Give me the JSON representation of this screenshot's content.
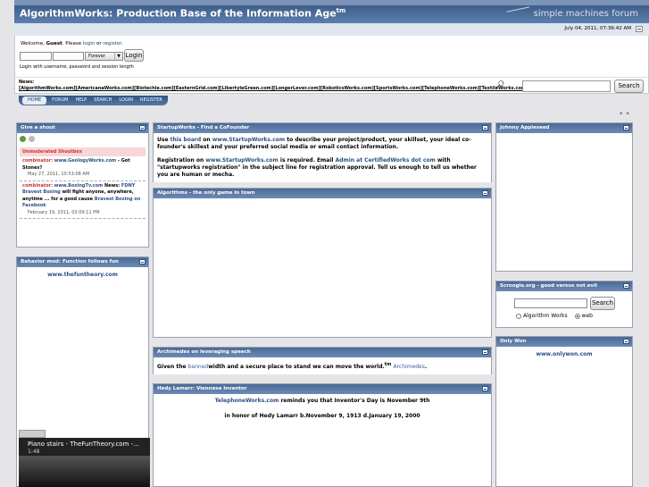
{
  "header": {
    "title": "AlgorithmWorks: Production Base of the Information Age",
    "title_sup": "tm",
    "brand": "simple machines forum"
  },
  "datetime": "July 04, 2011, 07:36:42 AM",
  "login": {
    "welcome_prefix": "Welcome, ",
    "guest": "Guest",
    "please": ". Please ",
    "login_link": "login",
    "or": " or ",
    "register_link": "register",
    "end": ".",
    "duration_option": "Forever",
    "login_button": "Login",
    "hint": "Login with username, password and session length"
  },
  "news": {
    "label": "News:",
    "links": "[AlgorithmWorks.com][AmericanaWorks.com][Biotechie.com][EasternGrid.com][LibertyleGreen.com][LongerLever.com][RoboticsWorks.com][SportsWorks.com][TelephoneWorks.com][TextileWorks.com][WLAB.com]"
  },
  "search": {
    "button": "Search"
  },
  "menu": [
    "HOME",
    "FORUM",
    "HELP",
    "SEARCH",
    "LOGIN",
    "REGISTER"
  ],
  "shout": {
    "title": "Give a shout",
    "unmoderated": "Unmoderated Shoutbox",
    "items": [
      {
        "user": "combinator:",
        "link": "www.GeologyWorks.com",
        "text": " - Got Stones?",
        "date": "May 27, 2011, 10:53:08 AM"
      },
      {
        "user": "combinator:",
        "link": "www.BoxingTv.com",
        "text_pre": " News: ",
        "link2": "FDNY Bravest Boxing",
        "text": " will fight anyone, anywhere, anytime ... for a good cause  ",
        "link3": "Bravest Boxing on Facebook",
        "date": "February 19, 2011, 02:09:11 PM"
      }
    ]
  },
  "behavior": {
    "title": "Behavior mod: Function follows fun",
    "link": "www.thefuntheory.com",
    "video_title": "Piano stairs - TheFunTheory.com -...",
    "video_duration": "1:48"
  },
  "startup": {
    "title": "StartupWorks - Find a CoFounder",
    "p1_pre": "Use ",
    "p1_link1": "this board",
    "p1_mid": " on ",
    "p1_link2": "www.StartupWorks.com",
    "p1_post": " to describe your project/product, your skillset, your ideal co-founder's skillest and your preferred social media or email contact information.",
    "p2_pre": "Registration on ",
    "p2_link1": "www.StartupWorks.com",
    "p2_mid": " is required.  Email ",
    "p2_link2": "Admin at CertifiedWorks dot com",
    "p2_post": " with \"startupworks registration\" in the subject line for registration approval.  Tell us enough to tell us whether you are human or mecha."
  },
  "algorithms": {
    "title": "Algorithms - the only game in town"
  },
  "archimedes": {
    "title": "Archimedes on leveraging speech",
    "pre": "Given the ",
    "link1": "banned",
    "mid": "width and a secure place to stand we can move the world.",
    "sup": "tm",
    "link2": "Archimedes",
    "end": "."
  },
  "hedy": {
    "title": "Hedy Lamarr: Viennese Inventor",
    "line1_link": "TelephoneWorks.com",
    "line1_post": " reminds you that Inventor's Day is November 9th",
    "line2": "in honor of Hedy Lamarr b.November 9, 1913 d.January 19, 2000"
  },
  "johnny": {
    "title": "Johnny Appleseed"
  },
  "scroogle": {
    "title": "Scroogle.org - good versus not evil",
    "button": "Search",
    "opt1": "Algorithm Works",
    "opt2": "web"
  },
  "onlywon": {
    "title": "Only Won",
    "link": "www.onlywon.com"
  }
}
